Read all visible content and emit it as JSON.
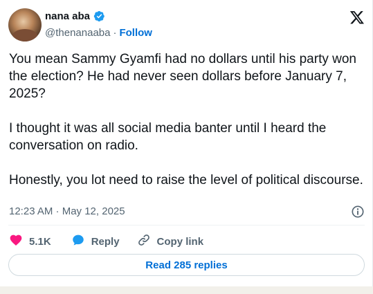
{
  "author": {
    "display_name": "nana aba",
    "handle": "@thenanaaba",
    "separator": "·",
    "follow_label": "Follow"
  },
  "tweet": {
    "text": "You mean Sammy Gyamfi had no dollars until his party won the election? He had never seen dollars before January 7, 2025?\n\nI thought it was all social media banter until I heard the conversation on radio.\n\nHonestly, you lot need to raise the level of political discourse.",
    "timestamp": "12:23 AM · May 12, 2025"
  },
  "actions": {
    "like_count": "5.1K",
    "reply_label": "Reply",
    "copy_link_label": "Copy link"
  },
  "replies_button": {
    "label": "Read 285 replies"
  },
  "colors": {
    "accent": "#006fd6",
    "verified": "#1d9bf0",
    "like": "#f91880",
    "muted": "#536471",
    "text": "#0f1419"
  },
  "icons": {
    "verified": "verified-badge-icon",
    "logo": "x-logo-icon",
    "info": "info-icon",
    "like": "heart-icon",
    "reply": "reply-bubble-icon",
    "copy_link": "link-icon"
  }
}
